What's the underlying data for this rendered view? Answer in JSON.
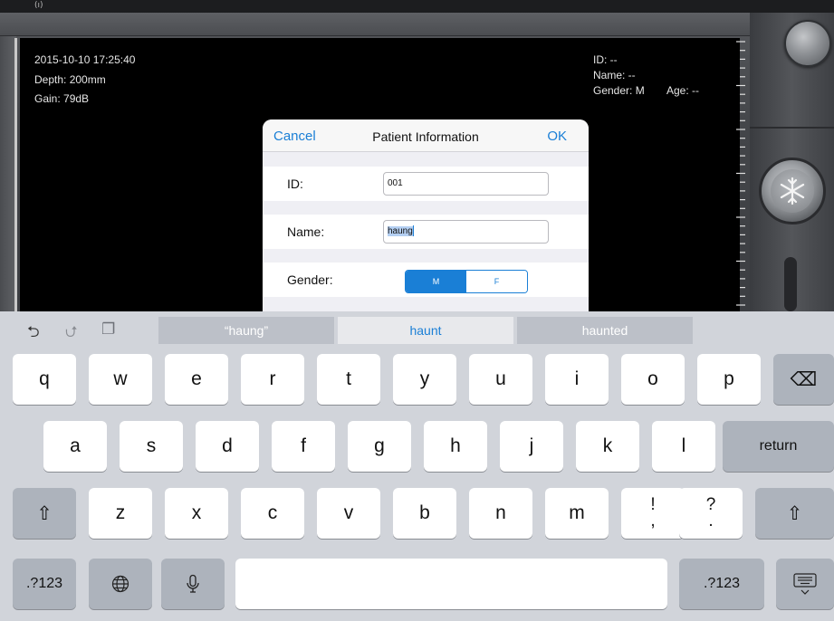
{
  "status": {
    "wifi_icon": "wifi-signal-icon",
    "wifi_glyph": "(̓̀)"
  },
  "overlay": {
    "datetime": "2015-10-10 17:25:40",
    "depth": "Depth: 200mm",
    "gain": "Gain: 79dB",
    "id": "ID: --",
    "name": "Name: --",
    "gender": "Gender: M",
    "age": "Age: --"
  },
  "dialog": {
    "cancel_label": "Cancel",
    "title": "Patient Information",
    "ok_label": "OK",
    "id_label": "ID:",
    "id_value": "001",
    "name_label": "Name:",
    "name_value": "haung",
    "gender_label": "Gender:",
    "gender_options": [
      "M",
      "F"
    ],
    "gender_selected": "M"
  },
  "keyboard": {
    "tools": {
      "undo": "⮌",
      "redo": "⮍",
      "paste": "❐"
    },
    "suggestions": [
      "“haung”",
      "haunt",
      "haunted"
    ],
    "row1": [
      "q",
      "w",
      "e",
      "r",
      "t",
      "y",
      "u",
      "i",
      "o",
      "p"
    ],
    "row2": [
      "a",
      "s",
      "d",
      "f",
      "g",
      "h",
      "j",
      "k",
      "l"
    ],
    "row3": [
      "z",
      "x",
      "c",
      "v",
      "b",
      "n",
      "m"
    ],
    "row3_punct": [
      [
        "!",
        ","
      ],
      [
        "?",
        "."
      ]
    ],
    "return_label": "return",
    "numbers_label": ".?123",
    "backspace_glyph": "⌫",
    "shift_glyph": "⇧",
    "globe_glyph": "🌐",
    "mic_glyph": "🎙",
    "hide_glyph": "⌨"
  },
  "colors": {
    "accent": "#1a7fd6",
    "key_bg": "#ffffff",
    "key_dark": "#adb3bc",
    "keyboard_bg": "#d1d4da"
  }
}
